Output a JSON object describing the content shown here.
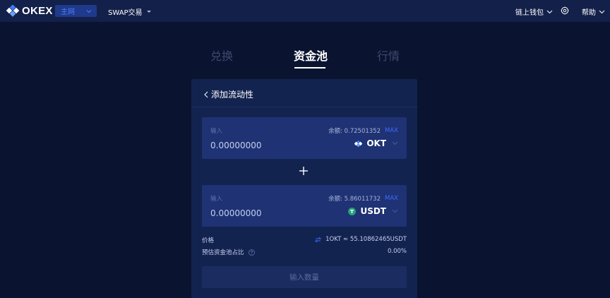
{
  "topbar": {
    "logo_text": "OKEX",
    "network": "主网",
    "swap_menu": "SWAP交易",
    "wallet_menu": "链上钱包",
    "help_menu": "帮助",
    "icons": [
      "okex-logo-icon",
      "chevron-down-icon",
      "caret-down-icon",
      "settings-icon"
    ]
  },
  "tabs": [
    {
      "label": "兑换",
      "active": false
    },
    {
      "label": "资金池",
      "active": true
    },
    {
      "label": "行情",
      "active": false
    }
  ],
  "panel": {
    "back_label": "添加流动性",
    "input1": {
      "label": "输入",
      "balance": "余额: 0.72501352",
      "max": "MAX",
      "placeholder": "0.00000000",
      "token": "OKT",
      "token_icon": "okt-token-icon"
    },
    "input2": {
      "label": "输入",
      "balance": "余额: 5.86011732",
      "max": "MAX",
      "placeholder": "0.00000000",
      "token": "USDT",
      "token_icon": "usdt-token-icon"
    },
    "price_label": "价格",
    "price_value": "1OKT ≈ 55.10862465USDT",
    "share_label": "预估资金池占比",
    "share_value": "0.00%",
    "submit_label": "输入数量"
  },
  "colors": {
    "background": "#0a1330",
    "topbar": "#13204a",
    "panel": "#13234f",
    "input_box": "#1e3274",
    "accent": "#3f6bff",
    "usdt": "#26a17b"
  }
}
